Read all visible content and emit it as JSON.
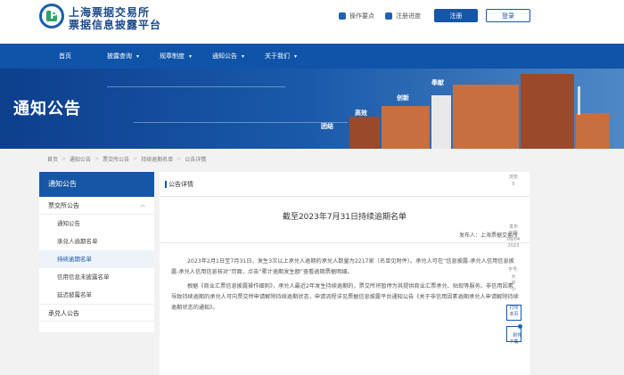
{
  "brand": {
    "line1": "上海票据交易所",
    "line2": "票据信息披露平台",
    "logo_letter": "P"
  },
  "toplinks": {
    "guide": "操作要点",
    "progress": "注册进度"
  },
  "auth": {
    "register": "注册",
    "login": "登录"
  },
  "nav": [
    {
      "label": "首页",
      "caret": ""
    },
    {
      "label": "披露查询",
      "caret": "▾"
    },
    {
      "label": "规章制度",
      "caret": "▾"
    },
    {
      "label": "通知公告",
      "caret": "▾"
    },
    {
      "label": "关于我们",
      "caret": "▾"
    }
  ],
  "banner": {
    "title": "通知公告",
    "keywords": [
      "团结",
      "高效",
      "创新",
      "奉献"
    ]
  },
  "breadcrumb": [
    "首页",
    "通知公告",
    "票交所公告",
    "持续逾期名单",
    "公告详情"
  ],
  "breadcrumb_sep": ">",
  "sidebar": {
    "title": "通知公告",
    "group1": "票交所公告",
    "group1_chev": "︿",
    "items": [
      "通知公告",
      "承兑人逾期名单",
      "持续逾期名单",
      "信用信息未披露名单",
      "延迟披露名单"
    ],
    "active_index": 2,
    "group2": "承兑人公告"
  },
  "content": {
    "header": "公告详情",
    "title": "截至2023年7月31日持续逾期名单",
    "publisher": "发布人：上海票据交易所",
    "paragraphs": [
      "2023年2月1日至7月31日，发生3次以上承兑人逾期的承兑人数量为2217家（名单见附件）。承兑人可在“信息披露-承兑人信用信息披露-承兑人信用信息核对”页面，点击“累计逾期发生额”查看逾期票据明细。",
      "根据《商业汇票信息披露操作细则》，承兑人最近2年发生持续逾期的，票交所将暂停为其提供商业汇票承兑、贴现等服务。非信用因素导致持续逾期的承兑人可向票交所申请解除持续逾期状态，申请流程详见票据信息披露平台通知公告《关于非信用因素逾期承兑人申请解除持续逾期状态的通知》。"
    ]
  },
  "tools": {
    "views_label": "浏览",
    "views_value": "5",
    "date_lines": [
      "发布",
      "日期:",
      "08/04",
      "2023"
    ],
    "font_lines": [
      "字号:",
      "大",
      "中",
      "小"
    ],
    "print": "打印\n本页",
    "download": "附件\n下载",
    "download_count": "0"
  },
  "colors": {
    "primary": "#1656a6",
    "nav": "#0f54a9",
    "brand_text": "#1b4a8a",
    "accent_green": "#2aa36a"
  }
}
